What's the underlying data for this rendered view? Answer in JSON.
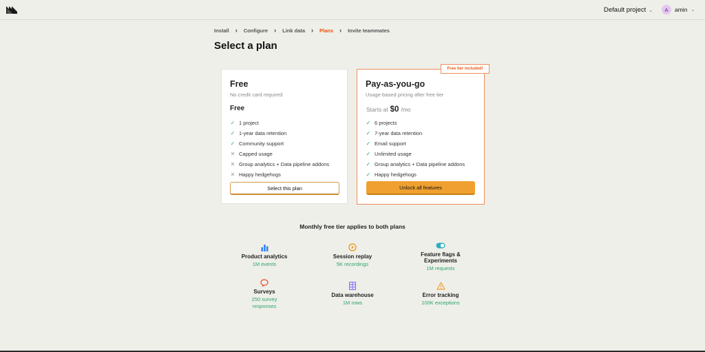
{
  "header": {
    "project_label": "Default project",
    "user_initial": "A",
    "user_name": "amin"
  },
  "breadcrumb": [
    "Install",
    "Configure",
    "Link data",
    "Plans",
    "Invite teammates"
  ],
  "page_title": "Select a plan",
  "plans": {
    "free": {
      "name": "Free",
      "subtitle": "No credit card required",
      "price": "Free",
      "features": [
        {
          "label": "1 project",
          "included": true
        },
        {
          "label": "1-year data retention",
          "included": true
        },
        {
          "label": "Community support",
          "included": true
        },
        {
          "label": "Capped usage",
          "included": false
        },
        {
          "label": "Group analytics + Data pipeline addons",
          "included": false
        },
        {
          "label": "Happy hedgehogs",
          "included": false
        }
      ],
      "button_label": "Select this plan"
    },
    "payg": {
      "name": "Pay-as-you-go",
      "subtitle": "Usage-based pricing after free tier",
      "starts_prefix": "Starts at",
      "starts_amount": "$0",
      "starts_suffix": "/mo",
      "badge": "Free tier included!",
      "features": [
        {
          "label": "6 projects",
          "included": true
        },
        {
          "label": "7-year data retention",
          "included": true
        },
        {
          "label": "Email support",
          "included": true
        },
        {
          "label": "Unlimited usage",
          "included": true
        },
        {
          "label": "Group analytics + Data pipeline addons",
          "included": true
        },
        {
          "label": "Happy hedgehogs",
          "included": true
        }
      ],
      "button_label": "Unlock all features"
    }
  },
  "free_tier": {
    "heading": "Monthly free tier applies to both plans",
    "products": [
      {
        "name": "Product analytics",
        "detail": "1M events",
        "icon": "bar-chart-icon"
      },
      {
        "name": "Session replay",
        "detail": "5K recordings",
        "icon": "play-circle-icon"
      },
      {
        "name": "Feature flags & Experiments",
        "detail": "1M requests",
        "icon": "toggle-icon"
      },
      {
        "name": "Surveys",
        "detail": "250 survey responses",
        "icon": "chat-bubble-icon"
      },
      {
        "name": "Data warehouse",
        "detail": "1M rows",
        "icon": "database-icon"
      },
      {
        "name": "Error tracking",
        "detail": "100K exceptions",
        "icon": "warning-icon"
      }
    ]
  },
  "colors": {
    "accent": "#f54e00",
    "button_primary": "#f0a030",
    "check": "#2ea36b",
    "background": "#eeefe9"
  }
}
